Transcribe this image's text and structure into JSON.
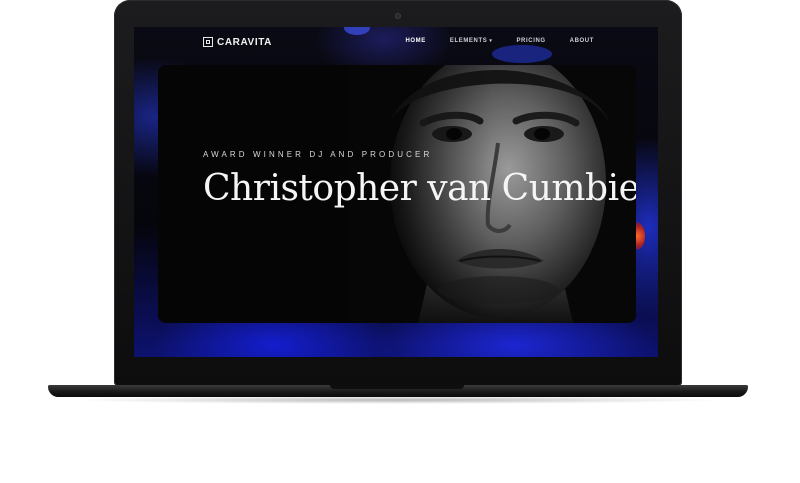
{
  "nav": {
    "brand": "CARAVITA",
    "items": [
      {
        "label": "HOME",
        "active": true
      },
      {
        "label": "ELEMENTS",
        "has_dropdown": true
      },
      {
        "label": "PRICING"
      },
      {
        "label": "ABOUT"
      }
    ]
  },
  "hero": {
    "subtitle": "AWARD WINNER DJ AND PRODUCER",
    "title": "Christopher van Cumbie"
  },
  "icons": {
    "brand": "square-logo-icon",
    "dropdown": "chevron-down-icon"
  },
  "colors": {
    "accent_blue": "#1a2be0",
    "background": "#050505",
    "text": "#f5f5f5"
  }
}
